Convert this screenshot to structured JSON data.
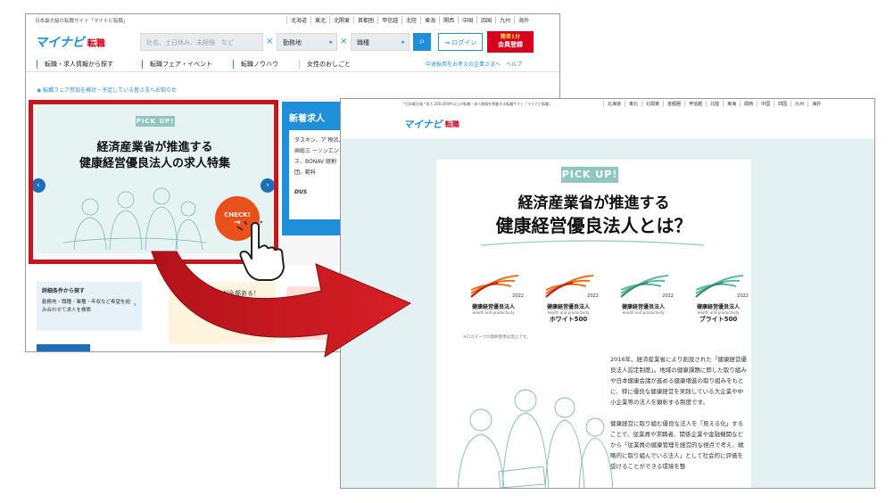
{
  "left_window": {
    "top_tagline": "日本最大級の転職サイト「マイナビ転職」",
    "regions": [
      "北海道",
      "東北",
      "北関東",
      "首都圏",
      "甲信越",
      "北陸",
      "東海",
      "関西",
      "中国",
      "四国",
      "九州",
      "海外"
    ],
    "logo_mark": "マイナビ",
    "logo_tenshoku": "転職",
    "search_placeholder": "社名、土日休み、未経験　など",
    "location_label": "勤務地",
    "jobtype_label": "職種",
    "login_label": "ログイン",
    "register_line1": "簡単1分",
    "register_line2": "会員登録",
    "nav_items": [
      "転職・求人情報から探す",
      "転職フェア・イベント",
      "転職ノウハウ",
      "女性のおしごと"
    ],
    "nav_right": "中途採用をお考えの企業さまへ　ヘルプ",
    "notice": "転職フェア参加を検討・予定している皆さまへお知らせ",
    "banner_pickup": "PICK UP!",
    "banner_title1": "経済産業省が推進する",
    "banner_title2": "健康経営優良法人の求人特集",
    "banner_check": "CHECK!",
    "new_jobs_title": "新着求人",
    "new_jobs_text": "ダスキン、ア 物流、画総三 ーソンエンタ ス、BONAV 経割団、範科",
    "new_jobs_footer": "DUS",
    "detail_title": "詳細条件から探す",
    "detail_text": "勤務地・職種・業種・年収など希望を組み合わせて求人を検索",
    "promo_text": "「知りたい」が全部ある！",
    "promo_tag": "転職"
  },
  "right_window": {
    "top_tagline": "*日本最大級 *求人 200,000件以上の転職・求人情報を掲載する転職サイト「マイナビ転職」",
    "regions": [
      "北海道",
      "東北",
      "北関東",
      "首都圏",
      "甲信越",
      "北陸",
      "東海",
      "関西",
      "中国",
      "四国",
      "九州",
      "海外"
    ],
    "logo_mark": "マイナビ",
    "logo_tenshoku": "転職",
    "pickup": "PICK UP!",
    "title1": "経済産業省が推進する",
    "title2": "健康経営優良法人とは？",
    "certs": [
      {
        "name": "健康経営優良法人",
        "sub": "Health and productivity",
        "extra": "",
        "year": "2022",
        "color": "#e8701c"
      },
      {
        "name": "健康経営優良法人",
        "sub": "Health and productivity",
        "extra": "ホワイト500",
        "year": "2022",
        "color": "#e8701c"
      },
      {
        "name": "健康経営優良法人",
        "sub": "Health and productivity",
        "extra": "",
        "year": "2022",
        "color": "#5cb8a0"
      },
      {
        "name": "健康経営優良法人",
        "sub": "Health and productivity",
        "extra": "ブライト500",
        "year": "2022",
        "color": "#5cb8a0"
      }
    ],
    "note": "※ロゴマークの無断使用は禁止です。",
    "para1": "2016年、経済産業省により創設された「健康経営優良法人認定制度」。地域の健康課題に即した取り組みや日本健康会議が進める健康増進の取り組みをもとに、特に優良な健康経営を実践している大企業や中小企業等の法人を顕彰する制度です。",
    "para2": "健康経営に取り組む優良な法人を「見える化」することで、従業員や求職者、関係企業や金融機関などから「従業員の健康管理を経営的な視点で考え、戦略的に取り組んでいる法人」として社会的に評価を受けることができる環境を整"
  },
  "colors": {
    "accent": "#1e8fd8",
    "brand_red": "#d6001c",
    "frame_red": "#c4161c",
    "teal": "#8fc6c2"
  }
}
